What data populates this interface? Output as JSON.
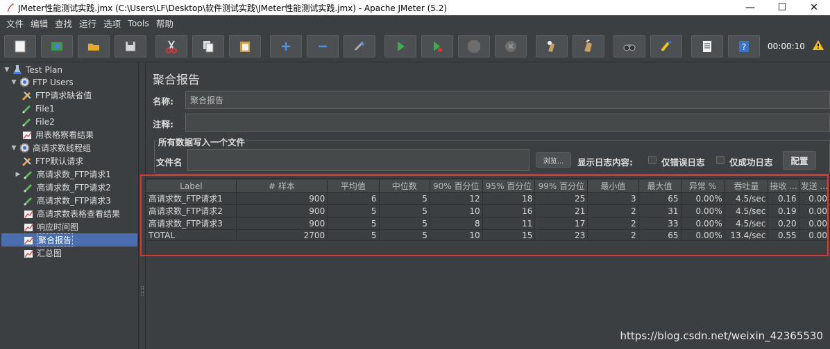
{
  "window": {
    "title": "JMeter性能测试实践.jmx (C:\\Users\\LF\\Desktop\\软件测试实践\\JMeter性能测试实践.jmx) - Apache JMeter (5.2)"
  },
  "menu": [
    "文件",
    "编辑",
    "查找",
    "运行",
    "选项",
    "Tools",
    "帮助"
  ],
  "toolbar": {
    "timer": "00:00:10",
    "buttons": [
      "new-icon",
      "template-icon",
      "open-icon",
      "save-icon",
      "cut-icon",
      "copy-icon",
      "paste-icon",
      "expand-icon",
      "collapse-icon",
      "toggle-icon",
      "start-icon",
      "start-no-pause-icon",
      "stop-icon",
      "shutdown-icon",
      "clear-icon",
      "clear-all-icon",
      "search-icon",
      "reset-search-icon",
      "function-helper-icon",
      "help-icon"
    ]
  },
  "tree": {
    "items": [
      {
        "label": "Test Plan"
      },
      {
        "label": "FTP Users"
      },
      {
        "label": "FTP请求缺省值"
      },
      {
        "label": "File1"
      },
      {
        "label": "File2"
      },
      {
        "label": "用表格察看结果"
      },
      {
        "label": "高请求数线程组"
      },
      {
        "label": "FTP默认请求"
      },
      {
        "label": "高请求数_FTP请求1"
      },
      {
        "label": "高请求数_FTP请求2"
      },
      {
        "label": "高请求数_FTP请求3"
      },
      {
        "label": "高请求数表格查看结果"
      },
      {
        "label": "响应时间图"
      },
      {
        "label": "聚合报告"
      },
      {
        "label": "汇总图"
      }
    ]
  },
  "panel": {
    "title": "聚合报告",
    "name_label": "名称:",
    "name_value": "聚合报告",
    "comment_label": "注释:",
    "comment_value": "",
    "file_group_label": "所有数据写入一个文件",
    "filename_label": "文件名",
    "filename_value": "",
    "browse_label": "浏览...",
    "log_label": "显示日志内容:",
    "errors_only_label": "仅错误日志",
    "success_only_label": "仅成功日志",
    "config_label": "配置"
  },
  "table": {
    "headers": [
      "Label",
      "# 样本",
      "平均值",
      "中位数",
      "90% 百分位",
      "95% 百分位",
      "99% 百分位",
      "最小值",
      "最大值",
      "异常 %",
      "吞吐量",
      "接收 ...",
      "发送 ..."
    ],
    "rows": [
      [
        "高请求数_FTP请求1",
        "900",
        "6",
        "5",
        "12",
        "18",
        "25",
        "3",
        "65",
        "0.00%",
        "4.5/sec",
        "0.16",
        "0.00"
      ],
      [
        "高请求数_FTP请求2",
        "900",
        "5",
        "5",
        "10",
        "16",
        "21",
        "2",
        "31",
        "0.00%",
        "4.5/sec",
        "0.19",
        "0.00"
      ],
      [
        "高请求数_FTP请求3",
        "900",
        "5",
        "5",
        "8",
        "11",
        "17",
        "2",
        "33",
        "0.00%",
        "4.5/sec",
        "0.20",
        "0.00"
      ],
      [
        "TOTAL",
        "2700",
        "5",
        "5",
        "10",
        "15",
        "23",
        "2",
        "65",
        "0.00%",
        "13.4/sec",
        "0.55",
        "0.00"
      ]
    ]
  },
  "watermark": "https://blog.csdn.net/weixin_42365530",
  "colors": {
    "background": "#3c3f41",
    "selection": "#4b6eaf",
    "highlight_box": "#e0362f"
  }
}
